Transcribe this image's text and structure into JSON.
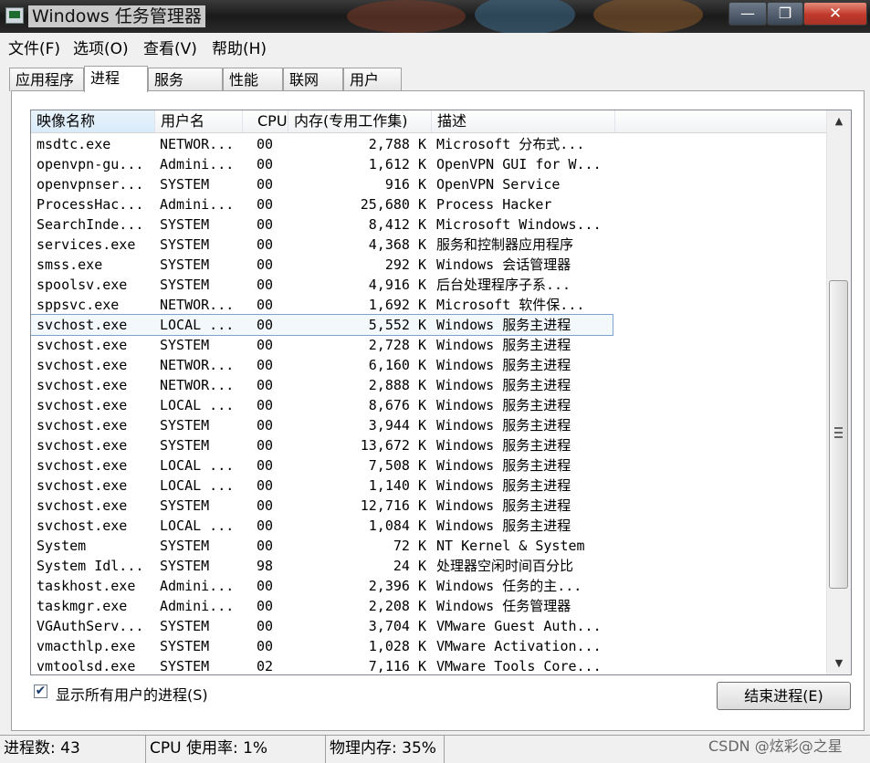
{
  "window": {
    "title": "Windows 任务管理器",
    "min_glyph": "—",
    "max_glyph": "❐",
    "close_glyph": "✕"
  },
  "menu": [
    "文件(F)",
    "选项(O)",
    "查看(V)",
    "帮助(H)"
  ],
  "tabs": [
    "应用程序",
    "进程",
    "服务",
    "性能",
    "联网",
    "用户"
  ],
  "active_tab": "进程",
  "columns": {
    "name": "映像名称",
    "user": "用户名",
    "cpu": "CPU",
    "mem": "内存(专用工作集)",
    "desc": "描述"
  },
  "rows": [
    {
      "name": "msdtc.exe",
      "user": "NETWOR...",
      "cpu": "00",
      "mem": "2,788 K",
      "desc": "Microsoft 分布式..."
    },
    {
      "name": "openvpn-gu...",
      "user": "Admini...",
      "cpu": "00",
      "mem": "1,612 K",
      "desc": "OpenVPN GUI for W..."
    },
    {
      "name": "openvpnser...",
      "user": "SYSTEM",
      "cpu": "00",
      "mem": "916 K",
      "desc": "OpenVPN Service"
    },
    {
      "name": "ProcessHac...",
      "user": "Admini...",
      "cpu": "00",
      "mem": "25,680 K",
      "desc": "Process Hacker"
    },
    {
      "name": "SearchInde...",
      "user": "SYSTEM",
      "cpu": "00",
      "mem": "8,412 K",
      "desc": "Microsoft Windows..."
    },
    {
      "name": "services.exe",
      "user": "SYSTEM",
      "cpu": "00",
      "mem": "4,368 K",
      "desc": "服务和控制器应用程序"
    },
    {
      "name": "smss.exe",
      "user": "SYSTEM",
      "cpu": "00",
      "mem": "292 K",
      "desc": "Windows 会话管理器"
    },
    {
      "name": "spoolsv.exe",
      "user": "SYSTEM",
      "cpu": "00",
      "mem": "4,916 K",
      "desc": "后台处理程序子系..."
    },
    {
      "name": "sppsvc.exe",
      "user": "NETWOR...",
      "cpu": "00",
      "mem": "1,692 K",
      "desc": "Microsoft 软件保..."
    },
    {
      "name": "svchost.exe",
      "user": "LOCAL ...",
      "cpu": "00",
      "mem": "5,552 K",
      "desc": "Windows 服务主进程",
      "selected": true
    },
    {
      "name": "svchost.exe",
      "user": "SYSTEM",
      "cpu": "00",
      "mem": "2,728 K",
      "desc": "Windows 服务主进程"
    },
    {
      "name": "svchost.exe",
      "user": "NETWOR...",
      "cpu": "00",
      "mem": "6,160 K",
      "desc": "Windows 服务主进程"
    },
    {
      "name": "svchost.exe",
      "user": "NETWOR...",
      "cpu": "00",
      "mem": "2,888 K",
      "desc": "Windows 服务主进程"
    },
    {
      "name": "svchost.exe",
      "user": "LOCAL ...",
      "cpu": "00",
      "mem": "8,676 K",
      "desc": "Windows 服务主进程"
    },
    {
      "name": "svchost.exe",
      "user": "SYSTEM",
      "cpu": "00",
      "mem": "3,944 K",
      "desc": "Windows 服务主进程"
    },
    {
      "name": "svchost.exe",
      "user": "SYSTEM",
      "cpu": "00",
      "mem": "13,672 K",
      "desc": "Windows 服务主进程"
    },
    {
      "name": "svchost.exe",
      "user": "LOCAL ...",
      "cpu": "00",
      "mem": "7,508 K",
      "desc": "Windows 服务主进程"
    },
    {
      "name": "svchost.exe",
      "user": "LOCAL ...",
      "cpu": "00",
      "mem": "1,140 K",
      "desc": "Windows 服务主进程"
    },
    {
      "name": "svchost.exe",
      "user": "SYSTEM",
      "cpu": "00",
      "mem": "12,716 K",
      "desc": "Windows 服务主进程"
    },
    {
      "name": "svchost.exe",
      "user": "LOCAL ...",
      "cpu": "00",
      "mem": "1,084 K",
      "desc": "Windows 服务主进程"
    },
    {
      "name": "System",
      "user": "SYSTEM",
      "cpu": "00",
      "mem": "72 K",
      "desc": "NT Kernel & System"
    },
    {
      "name": "System Idl...",
      "user": "SYSTEM",
      "cpu": "98",
      "mem": "24 K",
      "desc": "处理器空闲时间百分比"
    },
    {
      "name": "taskhost.exe",
      "user": "Admini...",
      "cpu": "00",
      "mem": "2,396 K",
      "desc": "Windows 任务的主..."
    },
    {
      "name": "taskmgr.exe",
      "user": "Admini...",
      "cpu": "00",
      "mem": "2,208 K",
      "desc": "Windows 任务管理器"
    },
    {
      "name": "VGAuthServ...",
      "user": "SYSTEM",
      "cpu": "00",
      "mem": "3,704 K",
      "desc": "VMware Guest Auth..."
    },
    {
      "name": "vmacthlp.exe",
      "user": "SYSTEM",
      "cpu": "00",
      "mem": "1,028 K",
      "desc": "VMware Activation..."
    },
    {
      "name": "vmtoolsd.exe",
      "user": "SYSTEM",
      "cpu": "02",
      "mem": "7,116 K",
      "desc": "VMware Tools Core..."
    }
  ],
  "show_all_users": {
    "label": "显示所有用户的进程(S)",
    "checked": true,
    "check_glyph": "✔"
  },
  "end_process_button": "结束进程(E)",
  "status": {
    "processes": "进程数: 43",
    "cpu": "CPU 使用率: 1%",
    "memory": "物理内存: 35%"
  },
  "watermark": "CSDN @炫彩@之星",
  "scrollbar": {
    "up": "▲",
    "down": "▼"
  }
}
